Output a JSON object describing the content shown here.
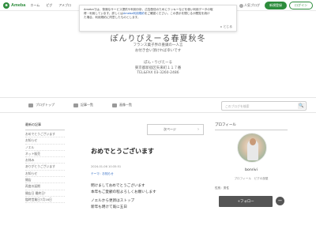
{
  "topbar": {
    "logo_mark": "a",
    "logo_text": "Ameba",
    "nav": [
      "ホーム",
      "ピグ",
      "アメブロ"
    ],
    "blog_link": "人気ブログ",
    "register": "新規登録",
    "login": "ログイン"
  },
  "cookie": {
    "line1": "Amebaでは、快適なサービス提供や利用分析、広告配信のためにクッキーなどを使い利用データの取",
    "line2a": "得・利用しています。詳しくは",
    "line2_link": "Ameba利用規約",
    "line2b": "をご確認ください。この表示を閉じるか閲覧を続け",
    "line3": "た場合、利用規約に同意したものとします。",
    "close": "× とじる"
  },
  "header": {
    "title": "ぽんりびえーる春夏秋冬",
    "sub1": "フランス菓子界の重鎮の一人言",
    "sub2": "お付き合い頂ければ幸いです",
    "addr1": "ぽん・りびえーる",
    "addr2": "東京都新宿区矢来町１１７番",
    "addr3": "TEL&FAX 03-3260-2486"
  },
  "menu": {
    "items": [
      "ブログトップ",
      "記事一覧",
      "画像一覧"
    ],
    "search_placeholder": "このブログを検索",
    "search_icon": "🔍"
  },
  "sidebar": {
    "head": "最新の記事",
    "items": [
      "おめでとうございます",
      "お知らせ",
      "ノエル",
      "ネット販売",
      "お休み",
      "ありがとうございます",
      "お知らせ",
      "開店",
      "再度の延期",
      "開店日 最終日！",
      "臨時営業日7月16日"
    ]
  },
  "article": {
    "next": "次ページ",
    "next_arrow": "›",
    "title": "おめでとうございます",
    "date": "2024-01-06 10:35:51",
    "theme": "テーマ：お知らせ",
    "body": [
      "明けましておめでとうございます",
      "本年もご愛顧の程よろしくお願いします",
      "",
      "ノエルから更新はストップ",
      "新年も明けて既に五日"
    ]
  },
  "profile": {
    "head": "プロフィール",
    "name": "bonrivi",
    "links": "プロフィール　ピグの部屋",
    "gender": "性別：男性",
    "follow": "+フォロー",
    "minus": "−"
  }
}
